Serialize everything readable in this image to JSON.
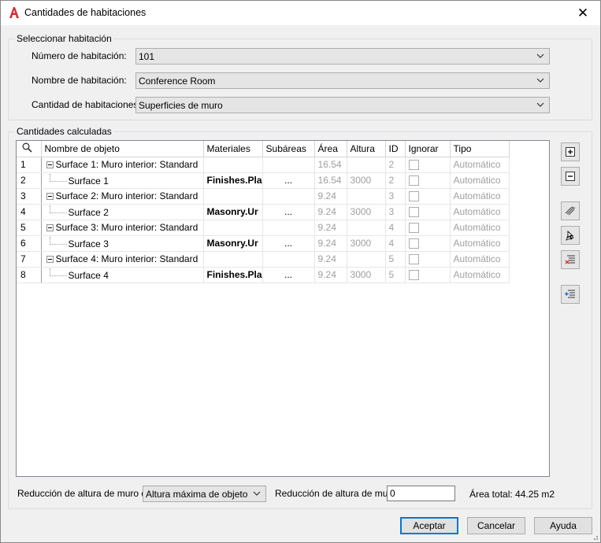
{
  "window": {
    "title": "Cantidades de habitaciones",
    "close_glyph": "✕",
    "app_icon": "autocad-a-icon"
  },
  "select_room": {
    "group_label": "Seleccionar habitación",
    "room_number_label": "Número de habitación:",
    "room_number_value": "101",
    "room_name_label": "Nombre de habitación:",
    "room_name_value": "Conference Room",
    "room_qty_label": "Cantidad de habitaciones:",
    "room_qty_value": "Superficies de muro"
  },
  "calc": {
    "group_label": "Cantidades calculadas",
    "columns": [
      "Nombre de objeto",
      "Materiales",
      "Subáreas",
      "Área",
      "Altura",
      "ID",
      "Ignorar",
      "Tipo"
    ],
    "rows": [
      {
        "num": "1",
        "name": "Surface 1: Muro interior: Standard",
        "material": "",
        "subareas": "",
        "area": "16.54",
        "height": "",
        "id": "2",
        "type": "Automático"
      },
      {
        "num": "2",
        "name": "Surface 1",
        "material": "Finishes.Pla",
        "subareas": "...",
        "area": "16.54",
        "height": "3000",
        "id": "2",
        "type": "Automático"
      },
      {
        "num": "3",
        "name": "Surface 2: Muro interior: Standard",
        "material": "",
        "subareas": "",
        "area": "9.24",
        "height": "",
        "id": "3",
        "type": "Automático"
      },
      {
        "num": "4",
        "name": "Surface 2",
        "material": "Masonry.Ur",
        "subareas": "...",
        "area": "9.24",
        "height": "3000",
        "id": "3",
        "type": "Automático"
      },
      {
        "num": "5",
        "name": "Surface 3: Muro interior: Standard",
        "material": "",
        "subareas": "",
        "area": "9.24",
        "height": "",
        "id": "4",
        "type": "Automático"
      },
      {
        "num": "6",
        "name": "Surface 3",
        "material": "Masonry.Ur",
        "subareas": "...",
        "area": "9.24",
        "height": "3000",
        "id": "4",
        "type": "Automático"
      },
      {
        "num": "7",
        "name": "Surface 4: Muro interior: Standard",
        "material": "",
        "subareas": "",
        "area": "9.24",
        "height": "",
        "id": "5",
        "type": "Automático"
      },
      {
        "num": "8",
        "name": "Surface 4",
        "material": "Finishes.Pla",
        "subareas": "...",
        "area": "9.24",
        "height": "3000",
        "id": "5",
        "type": "Automático"
      }
    ]
  },
  "side_buttons": [
    "expand-all-icon",
    "collapse-all-icon",
    "hatch-icon",
    "select-object-icon",
    "delete-rows-icon",
    "export-list-icon"
  ],
  "bottom": {
    "wall_reduction_of_label": "Reducción de altura de muro de",
    "wall_reduction_of_value": "Altura máxima de objeto",
    "wall_reduction_label": "Reducción de altura de muro",
    "wall_reduction_value": "0",
    "total_area": "Área total: 44.25 m2"
  },
  "buttons": {
    "ok": "Aceptar",
    "cancel": "Cancelar",
    "help": "Ayuda"
  }
}
